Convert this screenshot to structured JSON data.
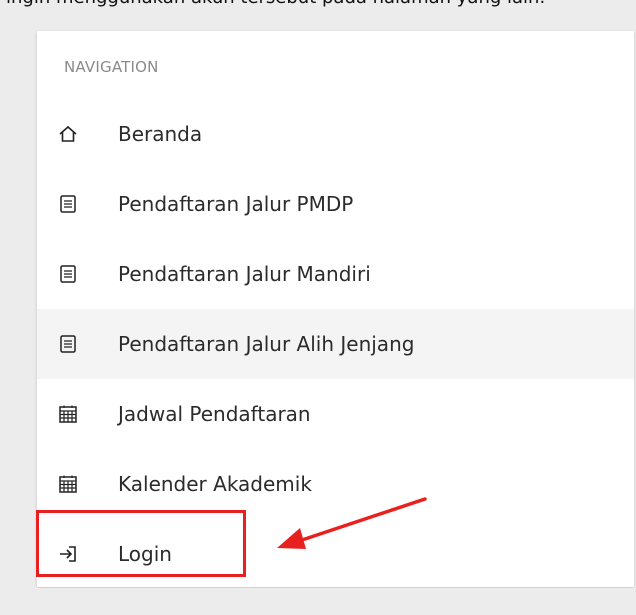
{
  "caption": "ingin menggunakan akun tersebut pada halaman yang lain.",
  "navigation": {
    "section_title": "NAVIGATION",
    "items": [
      {
        "label": "Beranda",
        "icon": "home-icon"
      },
      {
        "label": "Pendaftaran Jalur PMDP",
        "icon": "document-icon"
      },
      {
        "label": "Pendaftaran Jalur Mandiri",
        "icon": "document-icon"
      },
      {
        "label": "Pendaftaran Jalur Alih Jenjang",
        "icon": "document-icon",
        "hovered": true
      },
      {
        "label": "Jadwal Pendaftaran",
        "icon": "calendar-icon"
      },
      {
        "label": "Kalender Akademik",
        "icon": "calendar-icon"
      },
      {
        "label": "Login",
        "icon": "login-icon",
        "highlighted": true
      }
    ]
  },
  "annotation": {
    "box_color": "#e8201f",
    "arrow_color": "#e8201f",
    "hover_color": "#f4f4f4"
  }
}
